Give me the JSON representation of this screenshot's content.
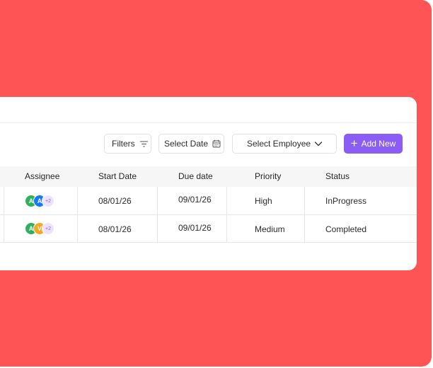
{
  "toolbar": {
    "filters_label": "Filters",
    "date_placeholder": "Select Date",
    "employee_placeholder": "Select Employee",
    "add_label": "Add New"
  },
  "table": {
    "columns": [
      "Assignee",
      "Start Date",
      "Due date",
      "Priority",
      "Status"
    ],
    "rows": [
      {
        "avatars": [
          {
            "initial": "A",
            "color": "#2eb05c"
          },
          {
            "initial": "A",
            "color": "#1877f2"
          }
        ],
        "more": "+2",
        "start_date": "08/01/26",
        "due_date": "09/01/26",
        "priority": "High",
        "status": "InProgress"
      },
      {
        "avatars": [
          {
            "initial": "A",
            "color": "#2eb05c"
          },
          {
            "initial": "V",
            "color": "#f5a623"
          }
        ],
        "more": "+2",
        "start_date": "08/01/26",
        "due_date": "09/01/26",
        "priority": "Medium",
        "status": "Completed"
      }
    ]
  },
  "colors": {
    "background": "#fe5455",
    "accent": "#8b5cf6"
  }
}
